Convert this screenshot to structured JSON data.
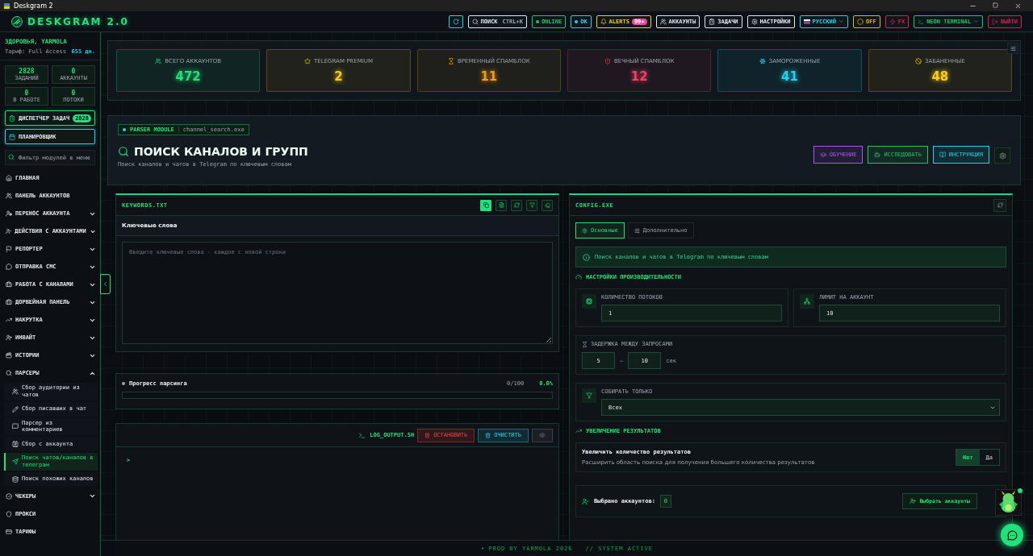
{
  "window": {
    "title": "Deskgram 2"
  },
  "header": {
    "logo": "DESKGRAM 2.0",
    "items": [
      {
        "kind": "icon",
        "color": "#22d3ee"
      },
      {
        "kind": "search",
        "label": "ПОИСК",
        "shortcut": "CTRL+K",
        "color": "#e5e7eb"
      },
      {
        "kind": "status",
        "label": "ONLINE",
        "color": "#22c55e"
      },
      {
        "kind": "status",
        "label": "OK",
        "color": "#22d3ee"
      },
      {
        "kind": "alerts",
        "label": "ALERTS",
        "badge": "99+",
        "color": "#facc15"
      },
      {
        "kind": "button",
        "label": "АККАУНТЫ",
        "color": "#e5e7eb"
      },
      {
        "kind": "button",
        "label": "ЗАДАЧИ",
        "color": "#e5e7eb"
      },
      {
        "kind": "button",
        "label": "НАСТРОЙКИ",
        "color": "#e5e7eb"
      },
      {
        "kind": "dropdown",
        "label": "РУССКИЙ",
        "color": "#22d3ee"
      },
      {
        "kind": "button",
        "label": "OFF",
        "color": "#eab308"
      },
      {
        "kind": "button",
        "label": "FX",
        "color": "#e11d48"
      },
      {
        "kind": "dropdown",
        "label": "NEON TERMINAL",
        "color": "#22c55e"
      },
      {
        "kind": "button",
        "label": "ВЫЙТИ",
        "color": "#e11d48"
      }
    ]
  },
  "sidebar": {
    "greeting": "ЗДОРОВЬЯ, YARMOLA",
    "plan": "Тариф: Full Access",
    "days": "655 дн.",
    "stats": [
      {
        "value": "2828",
        "label": "ЗАДАНИЙ"
      },
      {
        "value": "0",
        "label": "АККАУНТЫ"
      },
      {
        "value": "0",
        "label": "В РАБОТЕ"
      },
      {
        "value": "0",
        "label": "ПОТОКИ"
      }
    ],
    "dispatcher": {
      "label": "ДИСПЕТЧЕР ЗАДАЧ",
      "badge": "2828"
    },
    "scheduler": {
      "label": "ПЛАНИРОВЩИК"
    },
    "filter": {
      "placeholder": "Фильтр модулей в меню"
    },
    "items": [
      {
        "kind": "link",
        "label": "ГЛАВНАЯ"
      },
      {
        "kind": "link",
        "label": "ПАНЕЛЬ АККАУНТОВ"
      },
      {
        "kind": "group",
        "label": "ПЕРЕНОС АККАУНТА",
        "expanded": false
      },
      {
        "kind": "group",
        "label": "ДЕЙСТВИЯ С АККАУНТАМИ",
        "expanded": false
      },
      {
        "kind": "group",
        "label": "РЕПОРТЕР",
        "expanded": false
      },
      {
        "kind": "group",
        "label": "ОТПРАВКА СМС",
        "expanded": false
      },
      {
        "kind": "group",
        "label": "РАБОТА С КАНАЛАМИ",
        "expanded": false
      },
      {
        "kind": "group",
        "label": "ДОРВЕЙНАЯ ПАНЕЛЬ",
        "expanded": false
      },
      {
        "kind": "group",
        "label": "НАКРУТКА",
        "expanded": false
      },
      {
        "kind": "group",
        "label": "ИНВАЙТ",
        "expanded": false
      },
      {
        "kind": "group",
        "label": "ИСТОРИИ",
        "expanded": false
      },
      {
        "kind": "group",
        "label": "ПАРСЕРЫ",
        "expanded": true,
        "children": [
          {
            "label": "Сбор аудитории из чатов",
            "selected": false
          },
          {
            "label": "Сбор писавших в чат",
            "selected": false
          },
          {
            "label": "Парсер из комментариев",
            "selected": false
          },
          {
            "label": "Сбор с аккаунта",
            "selected": false
          },
          {
            "label": "Поиск чатов/каналов в телеграм",
            "selected": true
          },
          {
            "label": "Поиск похожих каналов",
            "selected": false
          }
        ]
      },
      {
        "kind": "group",
        "label": "ЧЕКЕРЫ",
        "expanded": false
      },
      {
        "kind": "link",
        "label": "ПРОКСИ"
      },
      {
        "kind": "link",
        "label": "ТАРИФЫ"
      }
    ]
  },
  "stats": [
    {
      "label": "ВСЕГО АККАУНТОВ",
      "value": "472",
      "color": "#22e07a"
    },
    {
      "label": "TELEGRAM PREMIUM",
      "value": "2",
      "color": "#facc15"
    },
    {
      "label": "ВРЕМЕННЫЙ СПАМБЛОК",
      "value": "11",
      "color": "#f59e0b"
    },
    {
      "label": "ВЕЧНЫЙ СПАМБЛОК",
      "value": "12",
      "color": "#f43f5e"
    },
    {
      "label": "ЗАМОРОЖЕННЫЕ",
      "value": "41",
      "color": "#22d3ee"
    },
    {
      "label": "ЗАБАНЕННЫЕ",
      "value": "48",
      "color": "#facc15"
    }
  ],
  "module": {
    "badge": "PARSER MODULE",
    "file": "channel_search.exe",
    "title": "ПОИСК КАНАЛОВ И ГРУПП",
    "subtitle": "Поиск каналов и чатов в Telegram по ключевым словам",
    "buttons": [
      {
        "label": "ОБУЧЕНИЕ",
        "color": "#a855f7"
      },
      {
        "label": "ИССЛЕДОВАТЬ",
        "color": "#22c55e"
      },
      {
        "label": "ИНСТРУКЦИЯ",
        "color": "#22d3ee"
      }
    ]
  },
  "keywords": {
    "title": "KEYWORDS.TXT",
    "tools": [
      {
        "selected": true
      },
      {
        "selected": false
      },
      {
        "selected": false
      },
      {
        "selected": false
      },
      {
        "selected": false
      }
    ],
    "label": "Ключевые слова",
    "placeholder": "Введите ключевые слова - каждое с новой строки"
  },
  "progress": {
    "label": "Прогресс парсинга",
    "count": "0/100",
    "percent": "0.0%",
    "level": 0
  },
  "log": {
    "title": "LOG_OUTPUT.SH",
    "stop": "ОСТАНОВИТЬ",
    "clear": "ОЧИСТИТЬ",
    "prompt": ">"
  },
  "config": {
    "title": "CONFIG.EXE",
    "tabs": [
      {
        "label": "Основные",
        "selected": true
      },
      {
        "label": "Дополнительно",
        "selected": false
      }
    ],
    "info": "Поиск каналов и чатов в Telegram по ключевым словам",
    "performance": {
      "title": "НАСТРОЙКИ ПРОИЗВОДИТЕЛЬНОСТИ",
      "fields": [
        {
          "label": "КОЛИЧЕСТВО ПОТОКОВ",
          "value": "1"
        },
        {
          "label": "ЛИМИТ НА АККАУНТ",
          "value": "10"
        }
      ]
    },
    "delay": {
      "label": "ЗАДЕРЖКА МЕЖДУ ЗАПРОСАМИ",
      "from": "5",
      "separator": "—",
      "to": "10",
      "unit": "сек"
    },
    "collect": {
      "label": "СОБИРАТЬ ТОЛЬКО",
      "value": "Всех"
    },
    "boost": {
      "title": "УВЕЛИЧЕНИЕ РЕЗУЛЬТАТОВ",
      "label": "Увеличить количество результатов",
      "description": "Расширить область поиска для получения большего количества результатов",
      "options": [
        {
          "label": "Нет",
          "selected": true
        },
        {
          "label": "Да",
          "selected": false
        }
      ]
    },
    "accounts": {
      "label": "Выбрано аккаунтов:",
      "count": "0",
      "button": "Выбрать аккаунты"
    }
  },
  "footer": {
    "bullet": "•",
    "credit": "PROD BY YARMOLA 2026",
    "status": "// SYSTEM ACTIVE"
  }
}
